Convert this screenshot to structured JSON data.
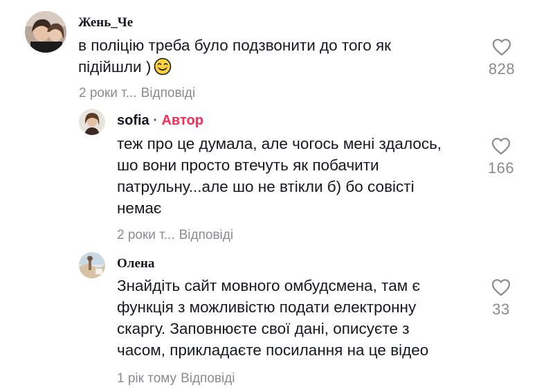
{
  "comments": [
    {
      "author": "Жень_Че",
      "text_lines": [
        "в поліцію треба було подзвонити до того як",
        "підійшли )"
      ],
      "emoji": "smiling-face-emoji",
      "time": "2 роки т...",
      "reply_label": "Відповіді",
      "likes": "828"
    },
    {
      "author": "sofia",
      "separator": "·",
      "badge": "Автор",
      "text_lines": [
        "теж про це думала, але чогось мені здалось,",
        "шо вони просто втечуть як побачити",
        "патрульну...але шо не втікли б) бо совісті",
        "немає"
      ],
      "time": "2 роки т...",
      "reply_label": "Відповіді",
      "likes": "166"
    },
    {
      "author": "Олена",
      "text_lines": [
        "Знайдіть сайт мовного омбудсмена, там є",
        "функція з можливістю подати електронну",
        "скаргу. Заповнюєте свої дані, описуєте з",
        "часом, прикладаєте посилання на це відео"
      ],
      "time": "1 рік тому",
      "reply_label": "Відповіді",
      "likes": "33"
    }
  ],
  "colors": {
    "text": "#161823",
    "muted": "#8a8b91",
    "author_badge": "#fe2c55",
    "background": "#ffffff"
  },
  "icons": {
    "like": "heart-outline-icon"
  }
}
